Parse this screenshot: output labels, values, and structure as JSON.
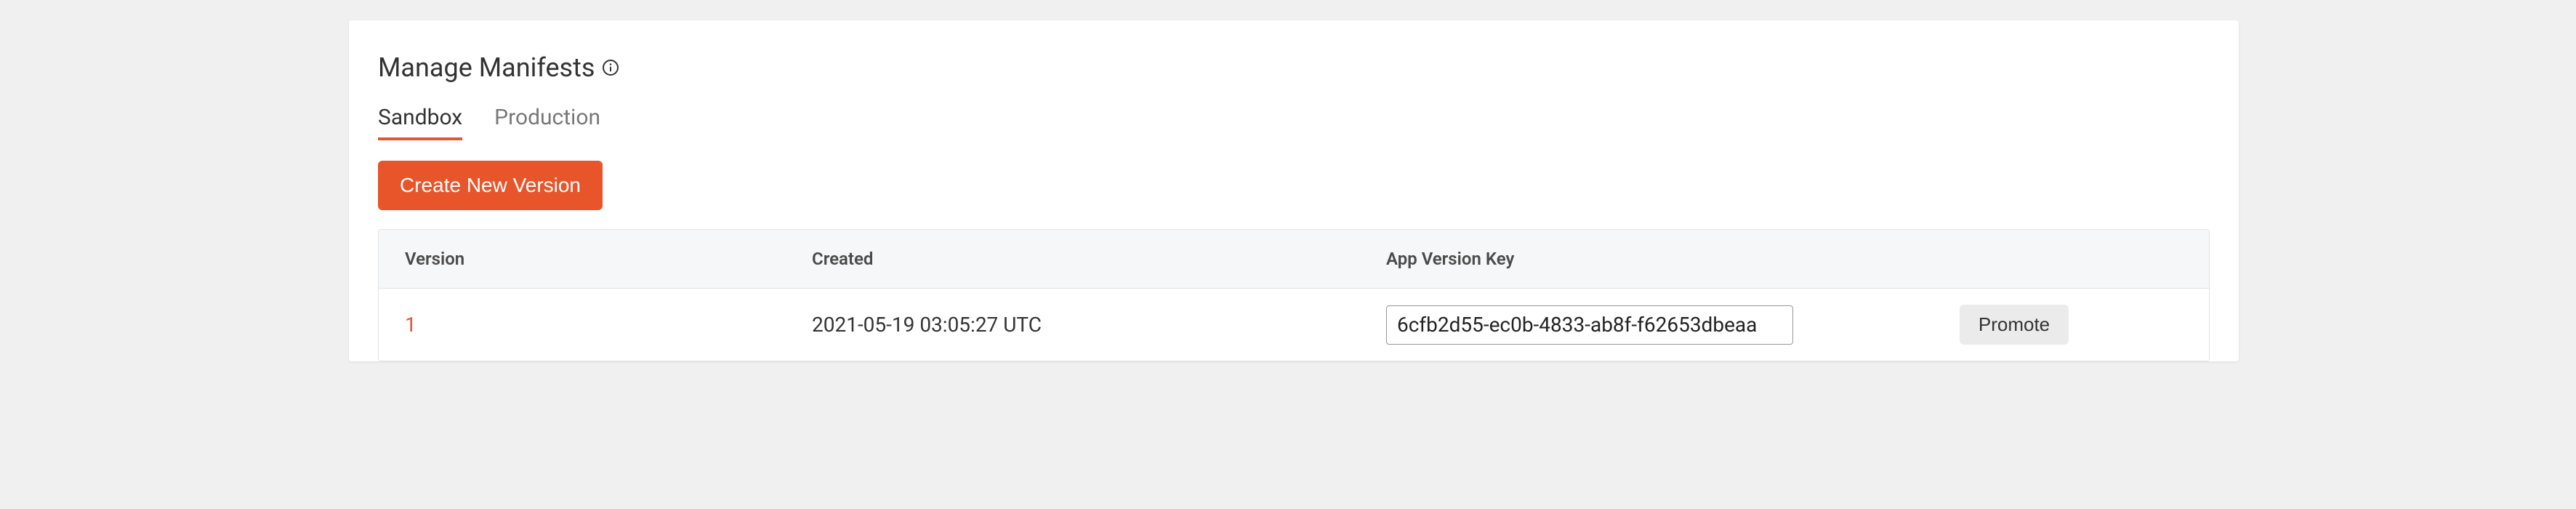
{
  "header": {
    "title": "Manage Manifests"
  },
  "tabs": {
    "sandbox": "Sandbox",
    "production": "Production"
  },
  "buttons": {
    "create_new_version": "Create New Version",
    "promote": "Promote"
  },
  "table": {
    "headers": {
      "version": "Version",
      "created": "Created",
      "app_version_key": "App Version Key"
    },
    "rows": [
      {
        "version": "1",
        "created": "2021-05-19 03:05:27 UTC",
        "app_version_key": "6cfb2d55-ec0b-4833-ab8f-f62653dbeaa"
      }
    ]
  }
}
